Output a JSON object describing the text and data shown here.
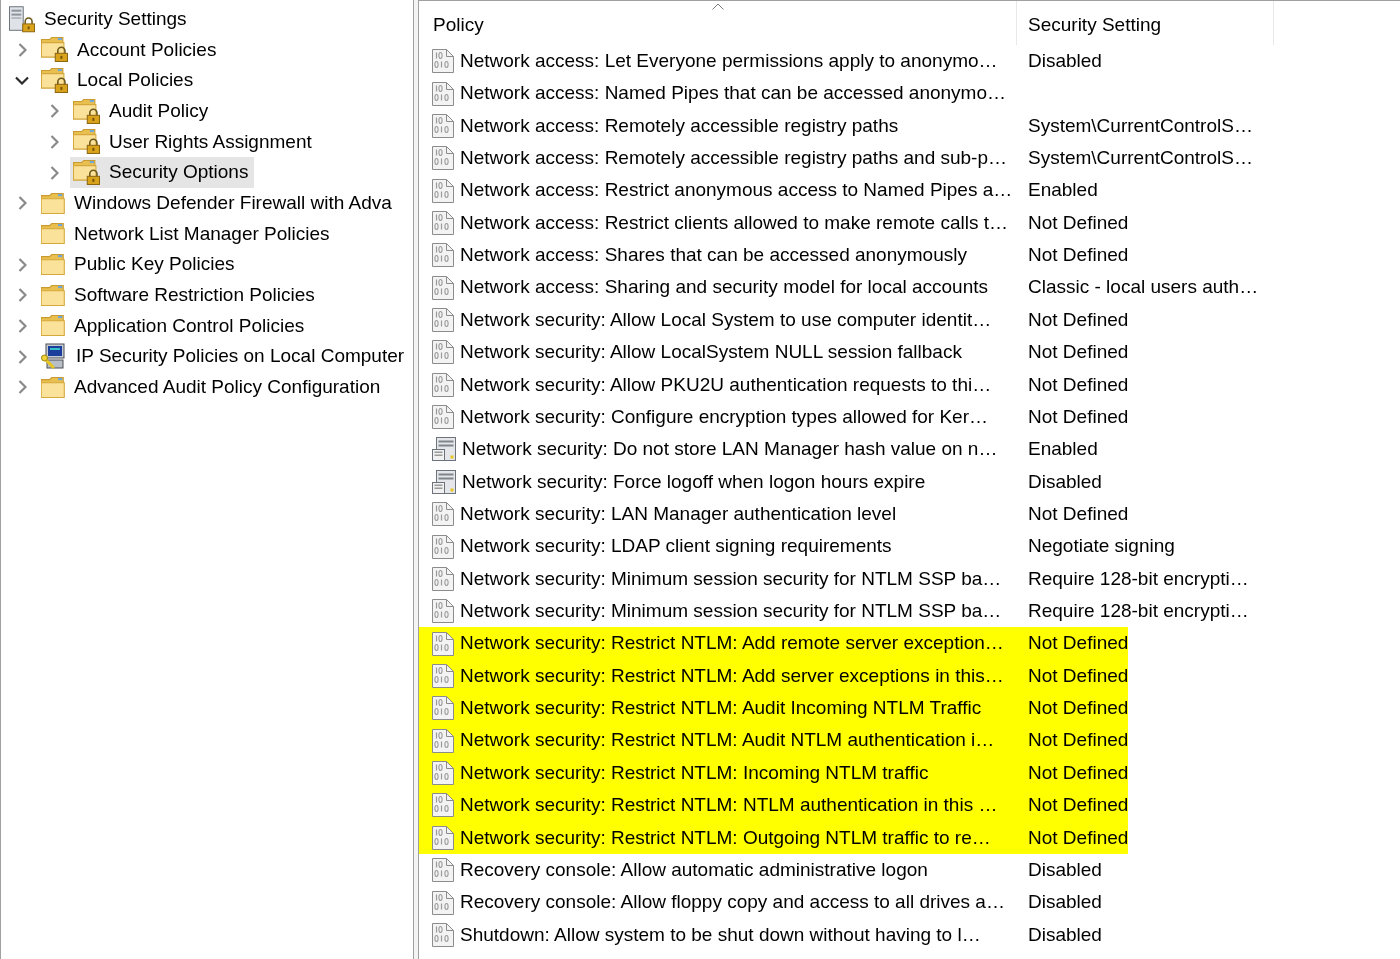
{
  "tree": {
    "items": [
      {
        "label": "Security Settings",
        "kind": "root",
        "selected": false,
        "children": [
          {
            "label": "Account Policies",
            "kind": "locked-folder",
            "selected": false,
            "expandable": true,
            "expanded": false
          },
          {
            "label": "Local Policies",
            "kind": "locked-folder",
            "selected": false,
            "expandable": true,
            "expanded": true,
            "children": [
              {
                "label": "Audit Policy",
                "kind": "locked-folder",
                "selected": false,
                "expandable": true,
                "expanded": false
              },
              {
                "label": "User Rights Assignment",
                "kind": "locked-folder",
                "selected": false,
                "expandable": true,
                "expanded": false
              },
              {
                "label": "Security Options",
                "kind": "locked-folder",
                "selected": true,
                "expandable": true,
                "expanded": false
              }
            ]
          },
          {
            "label": "Windows Defender Firewall with Adva",
            "kind": "folder",
            "selected": false,
            "expandable": true,
            "expanded": false
          },
          {
            "label": "Network List Manager Policies",
            "kind": "folder",
            "selected": false,
            "expandable": false
          },
          {
            "label": "Public Key Policies",
            "kind": "folder",
            "selected": false,
            "expandable": true,
            "expanded": false
          },
          {
            "label": "Software Restriction Policies",
            "kind": "folder",
            "selected": false,
            "expandable": true,
            "expanded": false
          },
          {
            "label": "Application Control Policies",
            "kind": "folder",
            "selected": false,
            "expandable": true,
            "expanded": false
          },
          {
            "label": "IP Security Policies on Local Computer",
            "kind": "ip-security",
            "selected": false,
            "expandable": true,
            "expanded": false
          },
          {
            "label": "Advanced Audit Policy Configuration",
            "kind": "folder",
            "selected": false,
            "expandable": true,
            "expanded": false
          }
        ]
      }
    ]
  },
  "policy_list": {
    "columns": [
      {
        "label": "Policy",
        "sorted": true
      },
      {
        "label": "Security Setting",
        "sorted": false
      }
    ],
    "rows": [
      {
        "policy": "Network access: Let Everyone permissions apply to anonymo…",
        "setting": "Disabled",
        "kind": "document",
        "highlighted": false
      },
      {
        "policy": "Network access: Named Pipes that can be accessed anonymo…",
        "kind": "document",
        "highlighted": false
      },
      {
        "policy": "Network access: Remotely accessible registry paths",
        "setting": "System\\CurrentControlS…",
        "kind": "document",
        "highlighted": false
      },
      {
        "policy": "Network access: Remotely accessible registry paths and sub-p…",
        "setting": "System\\CurrentControlS…",
        "kind": "document",
        "highlighted": false
      },
      {
        "policy": "Network access: Restrict anonymous access to Named Pipes a…",
        "setting": "Enabled",
        "kind": "document",
        "highlighted": false
      },
      {
        "policy": "Network access: Restrict clients allowed to make remote calls t…",
        "setting": "Not Defined",
        "kind": "document",
        "highlighted": false
      },
      {
        "policy": "Network access: Shares that can be accessed anonymously",
        "setting": "Not Defined",
        "kind": "document",
        "highlighted": false
      },
      {
        "policy": "Network access: Sharing and security model for local accounts",
        "setting": "Classic - local users auth…",
        "kind": "document",
        "highlighted": false
      },
      {
        "policy": "Network security: Allow Local System to use computer identit…",
        "setting": "Not Defined",
        "kind": "document",
        "highlighted": false
      },
      {
        "policy": "Network security: Allow LocalSystem NULL session fallback",
        "setting": "Not Defined",
        "kind": "document",
        "highlighted": false
      },
      {
        "policy": "Network security: Allow PKU2U authentication requests to thi…",
        "setting": "Not Defined",
        "kind": "document",
        "highlighted": false
      },
      {
        "policy": "Network security: Configure encryption types allowed for Ker…",
        "setting": "Not Defined",
        "kind": "document",
        "highlighted": false
      },
      {
        "policy": "Network security: Do not store LAN Manager hash value on n…",
        "setting": "Enabled",
        "kind": "server",
        "highlighted": false
      },
      {
        "policy": "Network security: Force logoff when logon hours expire",
        "setting": "Disabled",
        "kind": "server",
        "highlighted": false
      },
      {
        "policy": "Network security: LAN Manager authentication level",
        "setting": "Not Defined",
        "kind": "document",
        "highlighted": false
      },
      {
        "policy": "Network security: LDAP client signing requirements",
        "setting": "Negotiate signing",
        "kind": "document",
        "highlighted": false
      },
      {
        "policy": "Network security: Minimum session security for NTLM SSP ba…",
        "setting": "Require 128-bit encrypti…",
        "kind": "document",
        "highlighted": false
      },
      {
        "policy": "Network security: Minimum session security for NTLM SSP ba…",
        "setting": "Require 128-bit encrypti…",
        "kind": "document",
        "highlighted": false
      },
      {
        "policy": "Network security: Restrict NTLM: Add remote server exception…",
        "setting": "Not Defined",
        "kind": "document",
        "highlighted": true
      },
      {
        "policy": "Network security: Restrict NTLM: Add server exceptions in this…",
        "setting": "Not Defined",
        "kind": "document",
        "highlighted": true
      },
      {
        "policy": "Network security: Restrict NTLM: Audit Incoming NTLM Traffic",
        "setting": "Not Defined",
        "kind": "document",
        "highlighted": true
      },
      {
        "policy": "Network security: Restrict NTLM: Audit NTLM authentication i…",
        "setting": "Not Defined",
        "kind": "document",
        "highlighted": true
      },
      {
        "policy": "Network security: Restrict NTLM: Incoming NTLM traffic",
        "setting": "Not Defined",
        "kind": "document",
        "highlighted": true
      },
      {
        "policy": "Network security: Restrict NTLM: NTLM authentication in this …",
        "setting": "Not Defined",
        "kind": "document",
        "highlighted": true
      },
      {
        "policy": "Network security: Restrict NTLM: Outgoing NTLM traffic to re…",
        "setting": "Not Defined",
        "kind": "document",
        "highlighted": true
      },
      {
        "policy": "Recovery console: Allow automatic administrative logon",
        "setting": "Disabled",
        "kind": "document",
        "highlighted": false
      },
      {
        "policy": "Recovery console: Allow floppy copy and access to all drives a…",
        "setting": "Disabled",
        "kind": "document",
        "highlighted": false
      },
      {
        "policy": "Shutdown: Allow system to be shut down without having to l…",
        "setting": "Disabled",
        "kind": "document",
        "highlighted": false
      }
    ]
  }
}
